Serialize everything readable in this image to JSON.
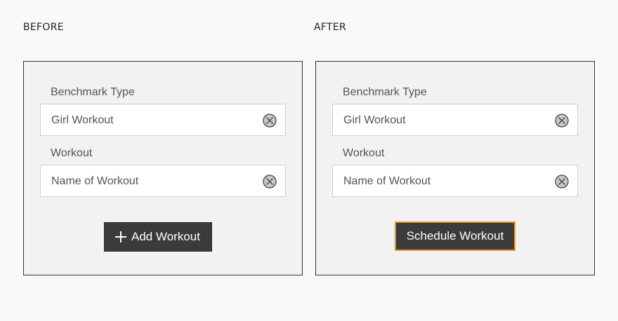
{
  "before": {
    "caption": "BEFORE",
    "fields": [
      {
        "label": "Benchmark Type",
        "value": "Girl Workout",
        "icon": "clear-circle-x-icon"
      },
      {
        "label": "Workout",
        "placeholder": "Name of Workout",
        "icon": "clear-circle-x-icon"
      }
    ],
    "button": {
      "icon": "plus-icon",
      "label": "Add Workout"
    }
  },
  "after": {
    "caption": "AFTER",
    "fields": [
      {
        "label": "Benchmark Type",
        "value": "Girl Workout",
        "icon": "clear-circle-x-icon"
      },
      {
        "label": "Workout",
        "placeholder": "Name of Workout",
        "icon": "clear-circle-x-icon"
      }
    ],
    "button": {
      "label": "Schedule Workout"
    }
  },
  "colors": {
    "page_background": "#f9f9f9",
    "panel_background": "#f1f2f1",
    "button_background": "#3b3b3b",
    "focus_outline": "#e8962b"
  }
}
